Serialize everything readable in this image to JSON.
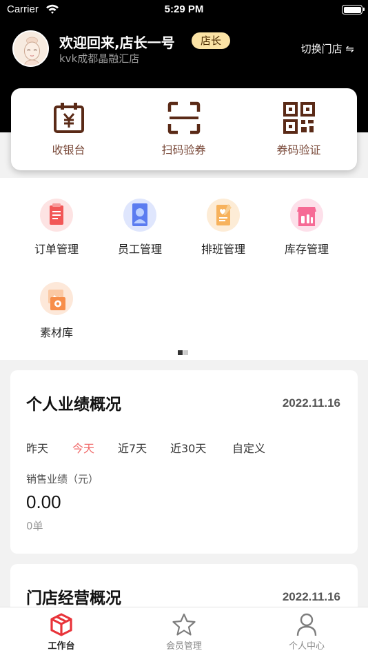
{
  "status_bar": {
    "carrier": "Carrier",
    "time": "5:29 PM"
  },
  "header": {
    "welcome": "欢迎回来,店长一号",
    "role": "店长",
    "store_name": "kvk成都晶融汇店",
    "switch_store": "切换门店 ⇋"
  },
  "quick_actions": [
    {
      "label": "收银台",
      "icon": "cashier-icon"
    },
    {
      "label": "扫码验券",
      "icon": "scan-icon"
    },
    {
      "label": "券码验证",
      "icon": "qr-code-icon"
    }
  ],
  "menu": [
    {
      "label": "订单管理",
      "icon": "order-icon"
    },
    {
      "label": "员工管理",
      "icon": "staff-icon"
    },
    {
      "label": "排班管理",
      "icon": "schedule-icon"
    },
    {
      "label": "库存管理",
      "icon": "inventory-icon"
    },
    {
      "label": "素材库",
      "icon": "material-icon"
    }
  ],
  "menu_pager": {
    "pages": 2,
    "current": 1
  },
  "performance": {
    "title": "个人业绩概况",
    "date": "2022.11.16",
    "tabs": [
      "昨天",
      "今天",
      "近7天",
      "近30天",
      "自定义"
    ],
    "active_tab": "今天",
    "sales_label": "销售业绩（元）",
    "sales_value": "0.00",
    "order_count": "0单"
  },
  "store_overview": {
    "title": "门店经营概况",
    "date": "2022.11.16"
  },
  "tabbar": [
    {
      "label": "工作台",
      "icon": "workbench-icon",
      "active": true
    },
    {
      "label": "会员管理",
      "icon": "star-icon",
      "active": false
    },
    {
      "label": "个人中心",
      "icon": "person-icon",
      "active": false
    }
  ],
  "colors": {
    "brown_icon": "#5a2a17",
    "accent_red": "#f06a6a",
    "badge_bg": "#fbe3a5"
  }
}
